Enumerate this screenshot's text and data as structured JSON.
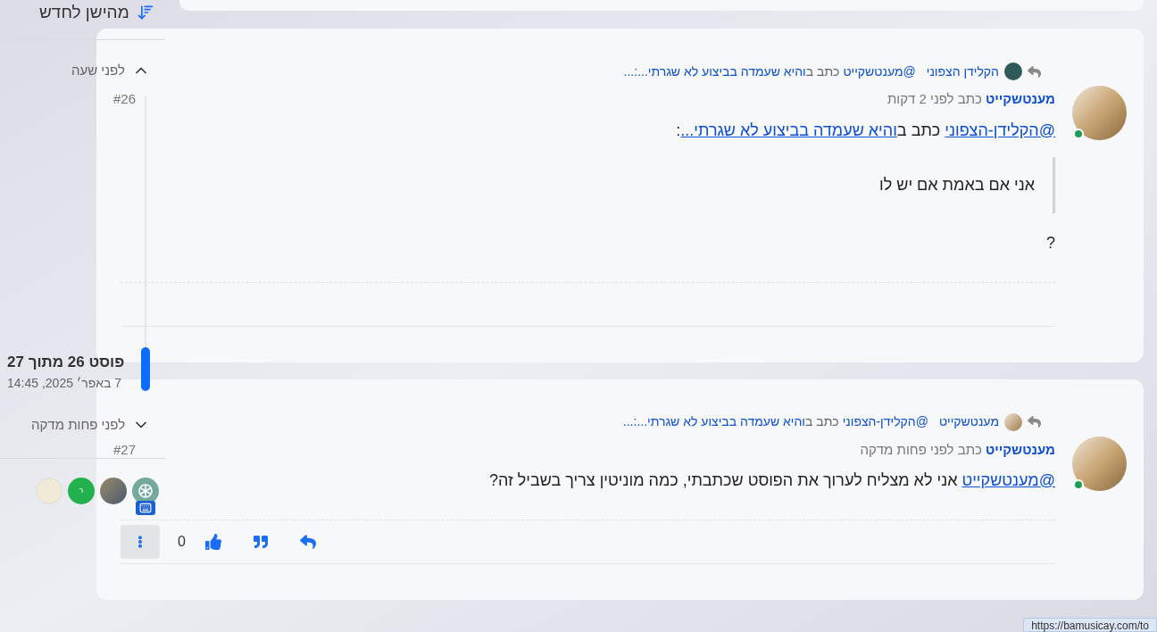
{
  "sort": {
    "label": "מהישן לחדש"
  },
  "timeline": {
    "top_label": "לפני שעה",
    "position": "פוסט 26 מתוך 27",
    "date": "7 באפר׳ 2025, 14:45",
    "bottom_label": "לפני פחות מדקה"
  },
  "participants": [
    {
      "kind": "logo",
      "keyboard_badge": true
    },
    {
      "kind": "photo",
      "keyboard_badge": false
    },
    {
      "kind": "letter",
      "letter": "ר",
      "color": "#22b14c",
      "keyboard_badge": false
    },
    {
      "kind": "logo-photo",
      "keyboard_badge": false
    }
  ],
  "posts": [
    {
      "number": "#26",
      "online": true,
      "author": "מענטשקייט",
      "meta": "כתב לפני 2 דקות",
      "reply_to": {
        "avatar": {
          "kind": "dark"
        },
        "name": "הקלידן הצפוני",
        "parts": [
          {
            "kind": "link",
            "text": "@מענטשקייט"
          },
          {
            "kind": "plain",
            "text": "כתב ב"
          },
          {
            "kind": "link",
            "text": "והיא שעמדה בביצוע לא שגרתי...:..."
          }
        ]
      },
      "body": [
        {
          "kind": "paragraph",
          "parts": [
            {
              "kind": "link",
              "text": "@הקלידן-הצפוני"
            },
            {
              "kind": "plain",
              "text": "כתב ב"
            },
            {
              "kind": "link",
              "text": "והיא שעמדה בביצוע לא שגרתי..."
            },
            {
              "kind": "plain",
              "text": ":"
            }
          ]
        },
        {
          "kind": "quote",
          "text": "אני אם באמת אם יש לו"
        },
        {
          "kind": "paragraph",
          "parts": [
            {
              "kind": "plain",
              "text": "?"
            }
          ]
        }
      ]
    },
    {
      "number": "#27",
      "online": true,
      "author": "מענטשקייט",
      "meta": "כתב לפני פחות מדקה",
      "reply_to": {
        "avatar": {
          "kind": "photo"
        },
        "name": "מענטשקייט",
        "parts": [
          {
            "kind": "link",
            "text": "@הקלידן-הצפוני"
          },
          {
            "kind": "plain",
            "text": "כתב ב"
          },
          {
            "kind": "link",
            "text": "והיא שעמדה בביצוע לא שגרתי...:..."
          }
        ]
      },
      "body": [
        {
          "kind": "paragraph",
          "parts": [
            {
              "kind": "link",
              "text": "@מענטשקייט"
            },
            {
              "kind": "plain",
              "text": "אני לא מצליח לערוך את הפוסט שכתבתי, כמה מוניטין צריך בשביל זה?"
            }
          ]
        }
      ],
      "actions": {
        "votes": "0"
      }
    }
  ],
  "status_url": "https://bamusicay.com/to"
}
